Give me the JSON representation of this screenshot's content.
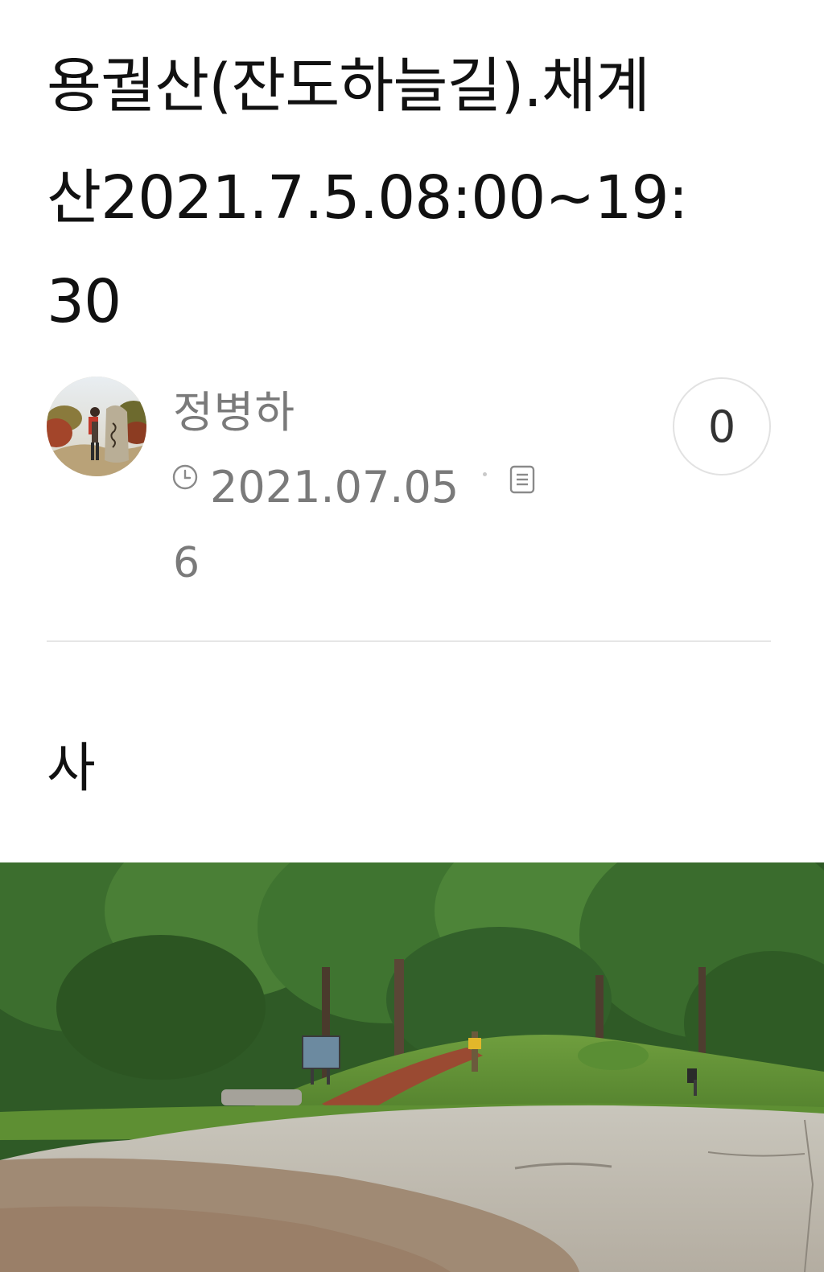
{
  "post": {
    "title_line1": "용궐산(잔도하늘길).채계",
    "title_line2": "산2021.7.5.08:00~19:",
    "title_line3": "30",
    "author": "정병하",
    "date": "2021.07.05",
    "views": "6",
    "comment_count": "0",
    "body_text": "사"
  },
  "icons": {
    "clock": "clock-icon",
    "document": "document-icon"
  },
  "colors": {
    "meta_text": "#7a7a7a",
    "divider": "#e6e6e6",
    "title_text": "#111111"
  }
}
